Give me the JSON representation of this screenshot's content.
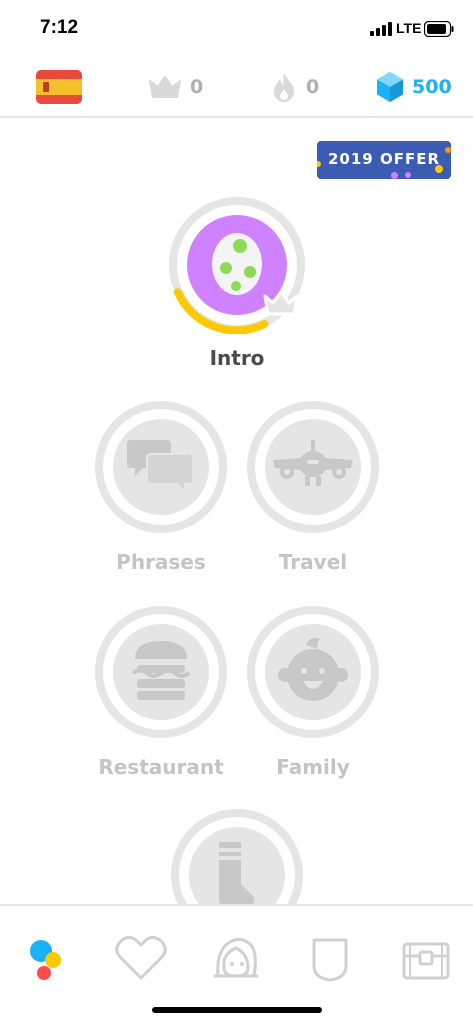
{
  "status": {
    "time": "7:12",
    "network": "LTE"
  },
  "stats": {
    "crowns": "0",
    "streak": "0",
    "gems": "500"
  },
  "offer": {
    "label": "2019 OFFER"
  },
  "skills": {
    "intro": "Intro",
    "phrases": "Phrases",
    "travel": "Travel",
    "restaurant": "Restaurant",
    "family": "Family"
  },
  "colors": {
    "gem_blue": "#1cb0f6",
    "offer_blue": "#3c5bb3",
    "intro_purple": "#ce82ff",
    "progress_yellow": "#ffc800",
    "locked_gray": "#e5e5e5"
  },
  "icons": [
    "spain-flag-icon",
    "crown-icon",
    "flame-icon",
    "gem-icon",
    "speech-bubbles-icon",
    "airplane-icon",
    "burger-icon",
    "baby-face-icon",
    "sock-icon",
    "learn-icon",
    "heart-icon",
    "profile-icon",
    "shield-icon",
    "chest-icon"
  ]
}
